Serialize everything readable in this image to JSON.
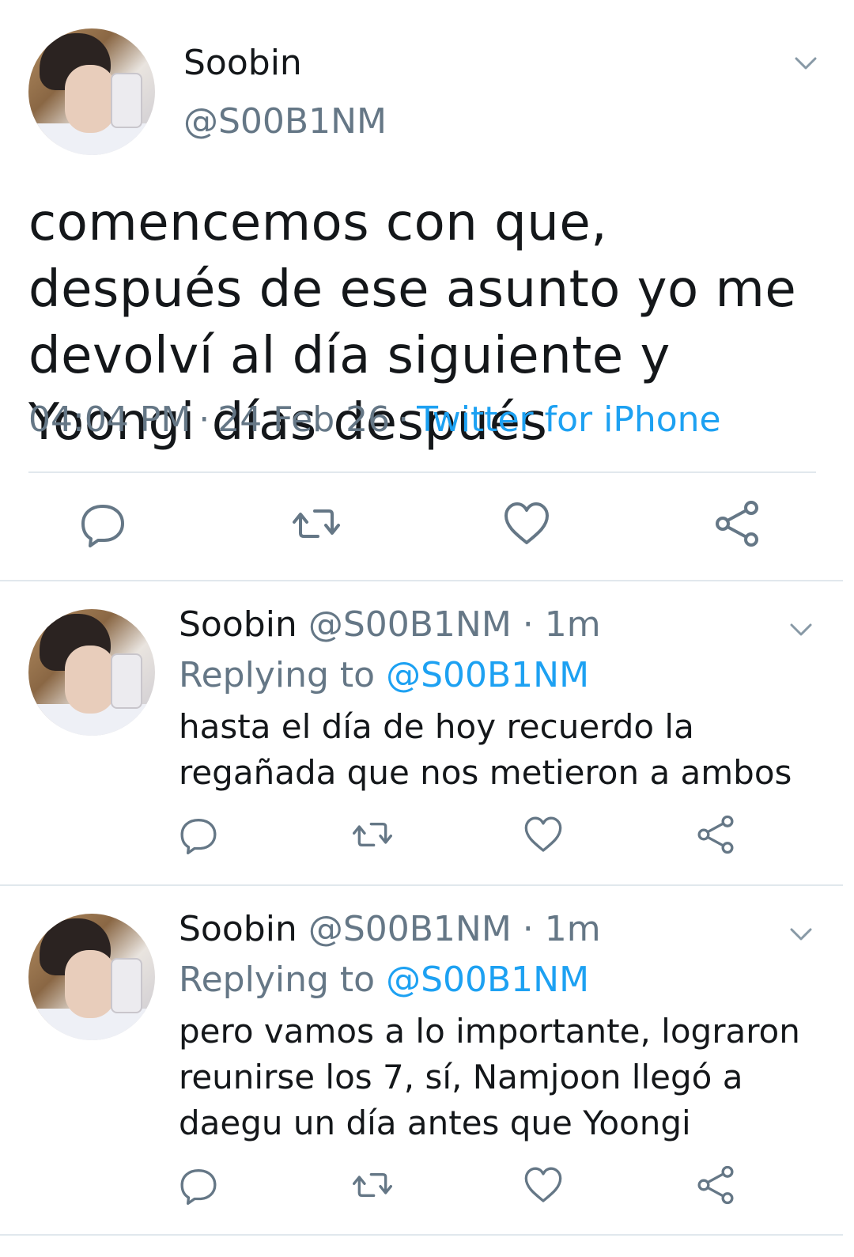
{
  "main_tweet": {
    "display_name": "Soobin",
    "handle": "@S00B1NM",
    "text": "comencemos con que, después de ese asunto yo me devolví al día siguiente y Yoongi días después",
    "time": "04:04 PM",
    "date": "24 Feb 26",
    "source": "Twitter for iPhone",
    "separator": "·",
    "icons": {
      "reply": "reply-icon",
      "retweet": "retweet-icon",
      "like": "heart-icon",
      "share": "share-icon",
      "menu": "chevron-down-icon"
    }
  },
  "replies": [
    {
      "display_name": "Soobin",
      "handle": "@S00B1NM",
      "dot": "·",
      "time": "1m",
      "replying_label": "Replying to",
      "replying_to": "@S00B1NM",
      "text": "hasta el día de hoy recuerdo la regañada que nos metieron a ambos"
    },
    {
      "display_name": "Soobin",
      "handle": "@S00B1NM",
      "dot": "·",
      "time": "1m",
      "replying_label": "Replying to",
      "replying_to": "@S00B1NM",
      "text": "pero vamos a lo importante, lograron reunirse los 7, sí, Namjoon llegó a daegu un día antes que Yoongi"
    }
  ],
  "colors": {
    "text": "#14171a",
    "secondary": "#657786",
    "accent": "#1da1f2",
    "divider": "#e1e8ed"
  }
}
